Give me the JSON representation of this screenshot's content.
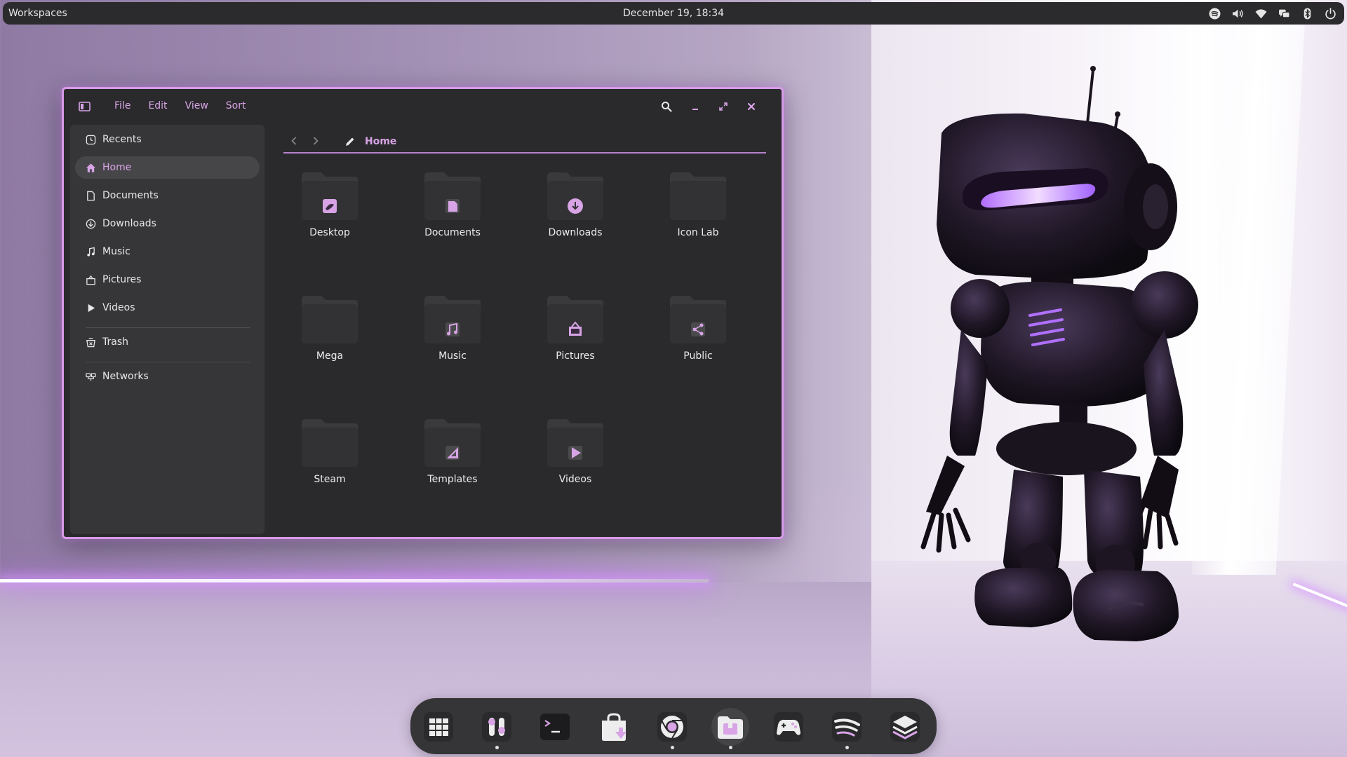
{
  "topbar": {
    "workspaces_label": "Workspaces",
    "datetime": "December 19, 18:34",
    "tray": [
      {
        "icon": "spotify-icon"
      },
      {
        "icon": "volume-icon"
      },
      {
        "icon": "wifi-icon"
      },
      {
        "icon": "chat-icon"
      },
      {
        "icon": "bluetooth-icon"
      },
      {
        "icon": "power-icon"
      }
    ]
  },
  "window": {
    "menus": [
      "File",
      "Edit",
      "View",
      "Sort"
    ],
    "accent_color": "#d8a4e6",
    "sidebar": {
      "items": [
        {
          "label": "Recents",
          "icon": "clock-icon"
        },
        {
          "label": "Home",
          "icon": "home-icon",
          "active": true
        },
        {
          "label": "Documents",
          "icon": "document-icon"
        },
        {
          "label": "Downloads",
          "icon": "download-icon"
        },
        {
          "label": "Music",
          "icon": "music-icon"
        },
        {
          "label": "Pictures",
          "icon": "pictures-icon"
        },
        {
          "label": "Videos",
          "icon": "play-icon"
        },
        {
          "label": "Trash",
          "icon": "trash-icon"
        },
        {
          "label": "Networks",
          "icon": "network-icon"
        }
      ]
    },
    "path": {
      "current": "Home"
    },
    "folders": [
      {
        "name": "Desktop",
        "emblem": "desktop"
      },
      {
        "name": "Documents",
        "emblem": "document"
      },
      {
        "name": "Downloads",
        "emblem": "download"
      },
      {
        "name": "Icon Lab",
        "emblem": "none"
      },
      {
        "name": "Mega",
        "emblem": "none"
      },
      {
        "name": "Music",
        "emblem": "music"
      },
      {
        "name": "Pictures",
        "emblem": "pictures"
      },
      {
        "name": "Public",
        "emblem": "share"
      },
      {
        "name": "Steam",
        "emblem": "none"
      },
      {
        "name": "Templates",
        "emblem": "template"
      },
      {
        "name": "Videos",
        "emblem": "video"
      }
    ]
  },
  "dock": {
    "apps": [
      {
        "icon": "app-grid-icon",
        "running": false
      },
      {
        "icon": "tweaks-icon",
        "running": true
      },
      {
        "icon": "terminal-icon",
        "running": false
      },
      {
        "icon": "software-store-icon",
        "running": false
      },
      {
        "icon": "chrome-icon",
        "running": true
      },
      {
        "icon": "files-icon",
        "running": true
      },
      {
        "icon": "games-icon",
        "running": false
      },
      {
        "icon": "spotify-dock-icon",
        "running": true
      },
      {
        "icon": "layers-icon",
        "running": false
      }
    ]
  }
}
